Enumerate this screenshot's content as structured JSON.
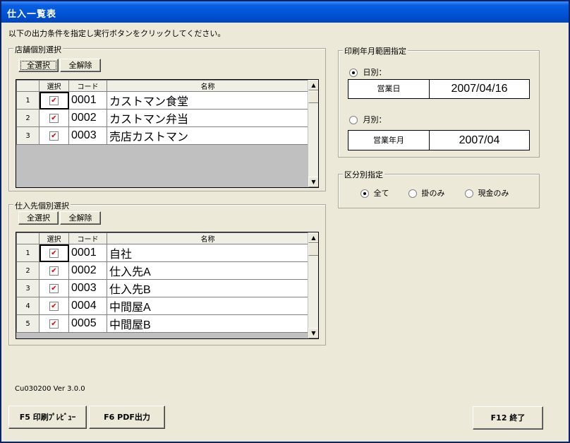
{
  "window": {
    "title": "仕入一覧表"
  },
  "instruction": "以下の出力条件を指定し実行ボタンをクリックしてください。",
  "store_group": {
    "title": "店舗個別選択",
    "select_all": "全選択",
    "clear_all": "全解除",
    "columns": [
      "選択",
      "コード",
      "名称"
    ],
    "rows": [
      {
        "no": "1",
        "checked": "✔",
        "code": "0001",
        "name": "カストマン食堂"
      },
      {
        "no": "2",
        "checked": "✔",
        "code": "0002",
        "name": "カストマン弁当"
      },
      {
        "no": "3",
        "checked": "✔",
        "code": "0003",
        "name": "売店カストマン"
      }
    ]
  },
  "supplier_group": {
    "title": "仕入先個別選択",
    "select_all": "全選択",
    "clear_all": "全解除",
    "columns": [
      "選択",
      "コード",
      "名称"
    ],
    "rows": [
      {
        "no": "1",
        "checked": "✔",
        "code": "0001",
        "name": "自社"
      },
      {
        "no": "2",
        "checked": "✔",
        "code": "0002",
        "name": "仕入先A"
      },
      {
        "no": "3",
        "checked": "✔",
        "code": "0003",
        "name": "仕入先B"
      },
      {
        "no": "4",
        "checked": "✔",
        "code": "0004",
        "name": "中間屋A"
      },
      {
        "no": "5",
        "checked": "✔",
        "code": "0005",
        "name": "中間屋B"
      }
    ]
  },
  "date_group": {
    "title": "印刷年月範囲指定",
    "daily_label": "日別：",
    "daily_field_label": "営業日",
    "daily_value": "2007/04/16",
    "monthly_label": "月別：",
    "monthly_field_label": "営業年月",
    "monthly_value": "2007/04",
    "selected": "daily"
  },
  "class_group": {
    "title": "区分別指定",
    "options": [
      "全て",
      "掛のみ",
      "現金のみ"
    ],
    "selected": "全て"
  },
  "version": "Cu030200 Ver 3.0.0",
  "buttons": {
    "preview": "F5 印刷ﾌﾟﾚﾋﾞｭｰ",
    "pdf": "F6 PDF出力",
    "exit": "F12 終了"
  },
  "colors": {
    "title_bar": "#0053d6",
    "window_bg": "#ece9d8",
    "check": "#e00000"
  }
}
